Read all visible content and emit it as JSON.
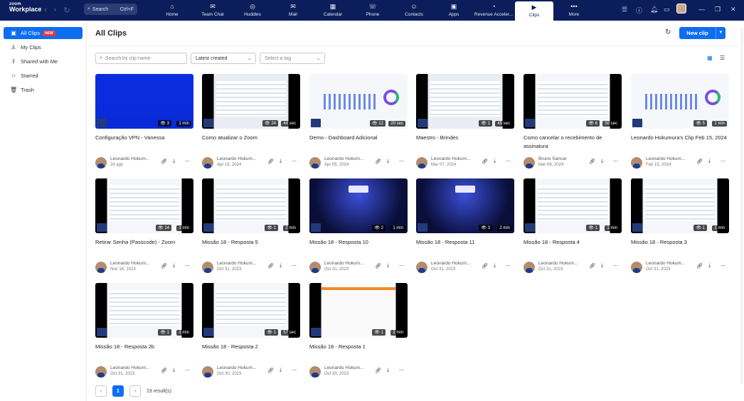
{
  "app": {
    "logo_top": "zoom",
    "logo_bottom": "Workplace"
  },
  "search": {
    "label": "Search",
    "shortcut": "Ctrl+F"
  },
  "nav": [
    {
      "label": "Home",
      "icon": "⌂"
    },
    {
      "label": "Team Chat",
      "icon": "✉",
      "badge": "99+"
    },
    {
      "label": "Huddles",
      "icon": "◎"
    },
    {
      "label": "Mail",
      "icon": "✉",
      "badge": "51"
    },
    {
      "label": "Calendar",
      "icon": "▦"
    },
    {
      "label": "Phone",
      "icon": "☏"
    },
    {
      "label": "Contacts",
      "icon": "☺"
    },
    {
      "label": "Apps",
      "icon": "▣",
      "badge": "3"
    },
    {
      "label": "Revenue Acceler...",
      "icon": "◔"
    },
    {
      "label": "Clips",
      "icon": "▶"
    },
    {
      "label": "More",
      "icon": "•••"
    }
  ],
  "sidebar": [
    {
      "label": "All Clips",
      "icon": "▣",
      "badge": "NEW"
    },
    {
      "label": "My Clips",
      "icon": "♙"
    },
    {
      "label": "Shared with Me",
      "icon": "⇪"
    },
    {
      "label": "Starred",
      "icon": "☆"
    },
    {
      "label": "Trash",
      "icon": "🗑"
    }
  ],
  "main": {
    "title": "All Clips",
    "new_clip": "New clip",
    "search_placeholder": "Search by clip name",
    "sort_value": "Latest created",
    "tag_placeholder": "Select a tag"
  },
  "clips": [
    {
      "title": "Configuração VPN - Vanessa",
      "views": "3",
      "duration": "1 min",
      "author": "Leonardo Hokum...",
      "date": "2d ago",
      "thumb": "blue"
    },
    {
      "title": "Como atualizar o Zoom",
      "views": "24",
      "duration": "44 sec",
      "author": "Leonardo Hokum...",
      "date": "Apr 15, 2024",
      "thumb": "dark"
    },
    {
      "title": "Demo - Dashboard Adicional",
      "views": "12",
      "duration": "20 sec",
      "author": "Leonardo Hokum...",
      "date": "Apr 05, 2024",
      "thumb": "dash"
    },
    {
      "title": "Maestro - Brindes",
      "views": "1",
      "duration": "45 sec",
      "author": "Leonardo Hokum...",
      "date": "Mar 07, 2024",
      "thumb": "dark"
    },
    {
      "title": "Como cancelar o recebimento de assinatura",
      "views": "6",
      "duration": "50 sec",
      "author": "Bruno Sancar",
      "date": "Mar 06, 2024",
      "thumb": "light"
    },
    {
      "title": "Leonardo Hokumura's Clip Feb 15, 2024",
      "views": "5",
      "duration": "1 min",
      "author": "Leonardo Hokum...",
      "date": "Feb 15, 2024",
      "thumb": "dash"
    },
    {
      "title": "Retirar Senha (Passcode) - Zoom",
      "views": "14",
      "duration": "1 min",
      "author": "Leonardo Hokum...",
      "date": "Nov 16, 2023",
      "thumb": "light"
    },
    {
      "title": "Missão 18 - Resposta 5",
      "views": "1",
      "duration": "2 min",
      "author": "Leonardo Hokum...",
      "date": "Oct 31, 2023",
      "thumb": "light"
    },
    {
      "title": "Missão 18 - Resposta 10",
      "views": "2",
      "duration": "1 min",
      "author": "Leonardo Hokum...",
      "date": "Oct 31, 2023",
      "thumb": "game"
    },
    {
      "title": "Missão 18 - Resposta 11",
      "views": "3",
      "duration": "2 min",
      "author": "Leonardo Hokum...",
      "date": "Oct 31, 2023",
      "thumb": "game"
    },
    {
      "title": "Missão 18 - Resposta 4",
      "views": "1",
      "duration": "1 min",
      "author": "Leonardo Hokum...",
      "date": "Oct 31, 2023",
      "thumb": "light"
    },
    {
      "title": "Missão 18 - Resposta 3",
      "views": "1",
      "duration": "1 min",
      "author": "Leonardo Hokum...",
      "date": "Oct 31, 2023",
      "thumb": "light"
    },
    {
      "title": "Missão 18 - Resposta 2b",
      "views": "1",
      "duration": "1 min",
      "author": "Leonardo Hokum...",
      "date": "Oct 31, 2023",
      "thumb": "light"
    },
    {
      "title": "Missão 18 - Resposta 2",
      "views": "1",
      "duration": "57 sec",
      "author": "Leonardo Hokum...",
      "date": "Oct 30, 2023",
      "thumb": "light"
    },
    {
      "title": "Missão 18 - Resposta 1",
      "views": "1",
      "duration": "2 min",
      "author": "Leonardo Hokum...",
      "date": "Oct 30, 2023",
      "thumb": "orange"
    }
  ],
  "pager": {
    "current": "1",
    "results": "19 result(s)"
  }
}
